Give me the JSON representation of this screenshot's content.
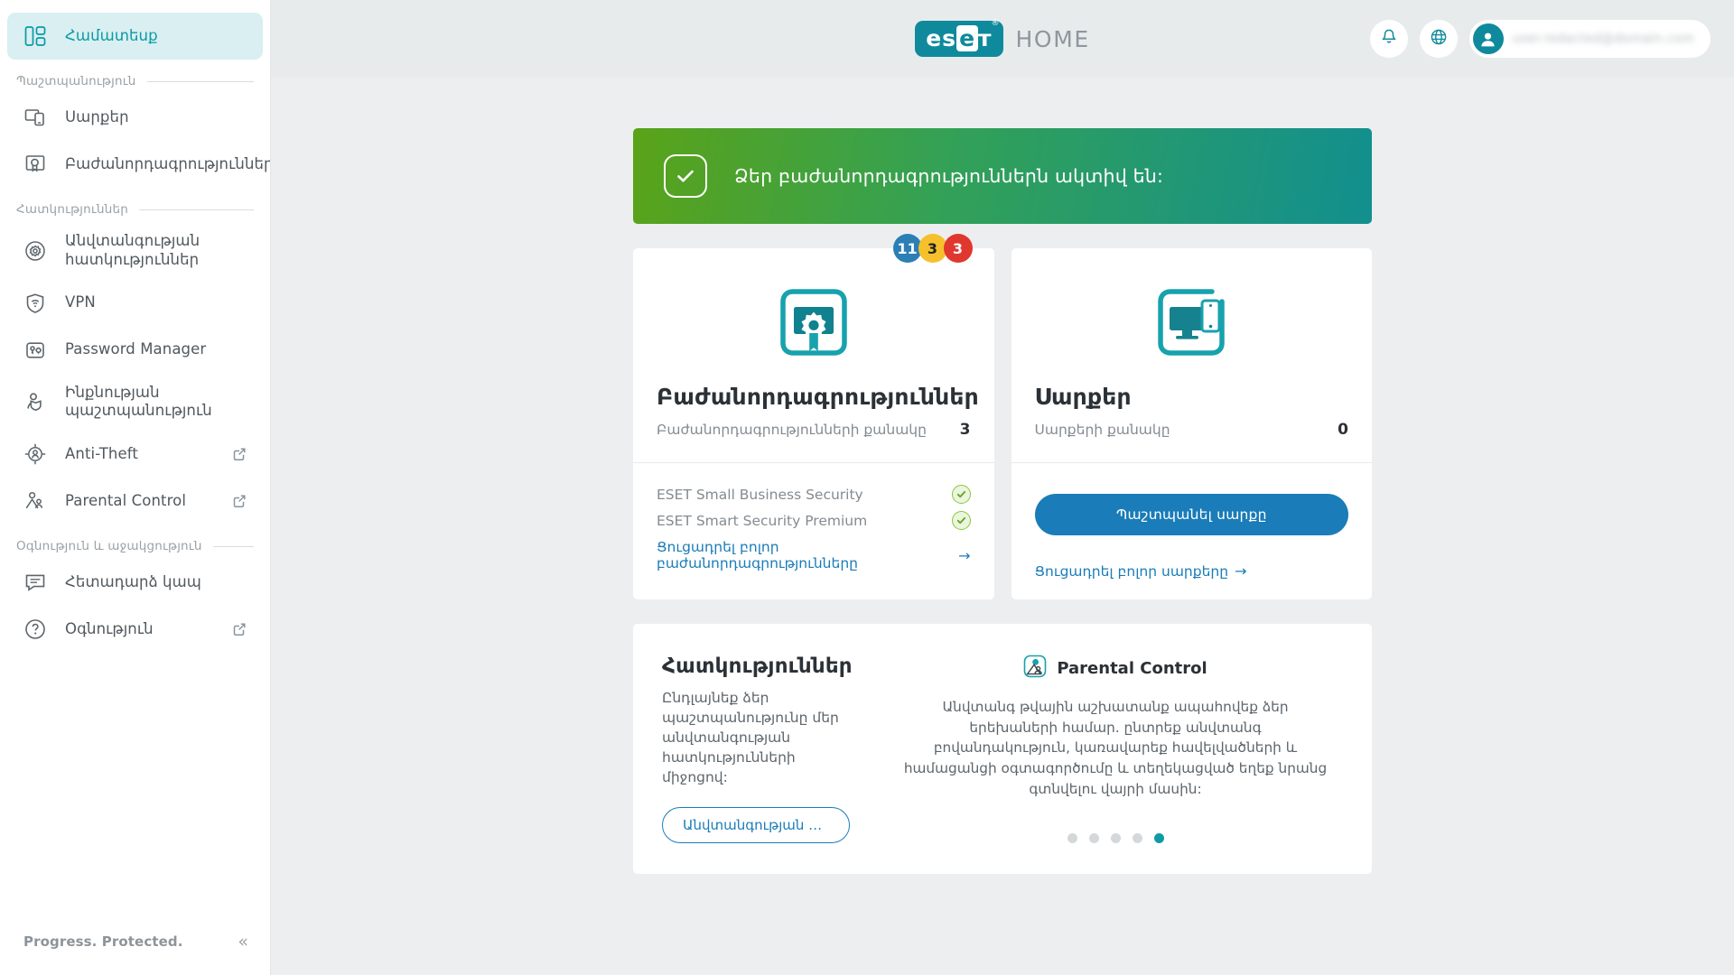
{
  "sidebar": {
    "items": [
      {
        "label": "Համատեսք",
        "icon": "dashboard-icon",
        "active": true,
        "external": false
      },
      {
        "label": "Սարքեր",
        "icon": "devices-icon",
        "active": false,
        "external": false
      },
      {
        "label": "Բաժանորդագրություններ",
        "icon": "certificate-icon",
        "active": false,
        "external": false
      },
      {
        "label": "Անվտանգության հատկություններ",
        "icon": "gear-icon",
        "active": false,
        "external": false
      },
      {
        "label": "VPN",
        "icon": "vpn-shield-icon",
        "active": false,
        "external": false
      },
      {
        "label": "Password Manager",
        "icon": "password-manager-icon",
        "active": false,
        "external": false
      },
      {
        "label": "Ինքնության պաշտպանություն",
        "icon": "identity-shield-icon",
        "active": false,
        "external": false
      },
      {
        "label": "Anti-Theft",
        "icon": "anti-theft-icon",
        "active": false,
        "external": true
      },
      {
        "label": "Parental Control",
        "icon": "parental-control-icon",
        "active": false,
        "external": true
      },
      {
        "label": "Հետադարձ կապ",
        "icon": "feedback-icon",
        "active": false,
        "external": false
      },
      {
        "label": "Օգնություն",
        "icon": "help-icon",
        "active": false,
        "external": true
      }
    ],
    "sections": {
      "protection": "Պաշտպանություն",
      "features": "Հատկություններ",
      "support": "Օգնություն և աջակցություն"
    },
    "footer": {
      "tagline": "Progress. Protected.",
      "collapse_icon": "chevron-double-left-icon"
    }
  },
  "topbar": {
    "logo_text": "eset",
    "logo_mark_left": "es",
    "logo_mark_right": "eт",
    "registered_mark": "®",
    "product": "HOME",
    "notifications_icon": "bell-icon",
    "language_icon": "globe-icon",
    "avatar_icon": "user-avatar-icon",
    "account_email": "user.redacted@domain.com"
  },
  "banner": {
    "text": "Ձեր բաժանորդագրություններն ակտիվ են:",
    "icon": "checkmark-icon",
    "gradient_from": "#5aa318",
    "gradient_to": "#128f8f"
  },
  "badges": [
    {
      "value": "11",
      "color": "#2b7fb5"
    },
    {
      "value": "3",
      "color": "#f6c02c",
      "text_color": "#1f2326"
    },
    {
      "value": "3",
      "color": "#e0372f"
    }
  ],
  "subscriptions_card": {
    "icon": "subscription-certificate-icon",
    "title": "Բաժանորդագրություններ",
    "stat_label": "Բաժանորդագրությունների քանակը",
    "stat_value": "3",
    "items": [
      {
        "name": "ESET Small Business Security",
        "status_icon": "check-circle-icon"
      },
      {
        "name": "ESET Smart Security Premium",
        "status_icon": "check-circle-icon"
      }
    ],
    "link": "Ցուցադրել բոլոր բաժանորդագրությունները",
    "link_arrow": "→"
  },
  "devices_card": {
    "icon": "devices-monitor-phone-icon",
    "title": "Սարքեր",
    "stat_label": "Սարքերի քանակը",
    "stat_value": "0",
    "button": "Պաշտպանել սարքը",
    "link": "Ցուցադրել բոլոր սարքերը",
    "link_arrow": "→"
  },
  "features_card": {
    "title": "Հատկություններ",
    "description": "Ընդլայնեք ձեր պաշտպանությունը մեր անվտանգության հատկությունների միջոցով:",
    "button": "Անվտանգության հ...",
    "promo": {
      "icon": "parental-control-icon",
      "name": "Parental Control",
      "text": "Անվտանգ թվային աշխատանք ապահովեք ձեր երեխաների համար. ընտրեք անվտանգ բովանդակություն, կառավարեք հավելվածների և համացանցի օգտագործումը և տեղեկացված եղեք նրանց գտնվելու վայրի մասին:"
    },
    "carousel": {
      "count": 5,
      "active_index": 4,
      "active_color": "#0f9aa8"
    }
  }
}
